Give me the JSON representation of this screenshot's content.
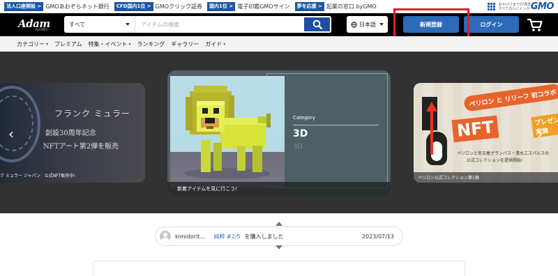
{
  "gmo_bar": {
    "items": [
      {
        "badge": "法人口座開設 >",
        "label": "GMOあおぞらネット銀行"
      },
      {
        "badge": "CFD国内1位 >",
        "label": "GMOクリック証券"
      },
      {
        "badge": "国内1位 >",
        "label": "電子印鑑GMOサイン"
      },
      {
        "badge": "夢を応援 >",
        "label": "起業の窓口 byGMO"
      }
    ],
    "tagline_1": "おかげさまで27周年",
    "tagline_2": "すべての人にインターネット",
    "logo": "GMO"
  },
  "header": {
    "logo": "Adam",
    "logo_sub": "byGMO",
    "search": {
      "category": "すべて",
      "placeholder": "アイテムの検索"
    },
    "language": "日本語",
    "signup_label": "新規登録",
    "login_label": "ログイン"
  },
  "nav": {
    "items": [
      {
        "label": "カテゴリー",
        "dropdown": "▾"
      },
      {
        "label": "プレミアム",
        "dropdown": ""
      },
      {
        "label": "特集・イベント",
        "dropdown": "▾"
      },
      {
        "label": "ランキング",
        "dropdown": ""
      },
      {
        "label": "ギャラリー",
        "dropdown": ""
      },
      {
        "label": "ガイド",
        "dropdown": "▾"
      }
    ]
  },
  "hero": {
    "left": {
      "title": "フランク ミュラー",
      "line2": "創設30周年記念",
      "line3": "NFTアート第2弾を販売",
      "caption": "ク ミュラー ジャパン　公式NFT販売中!"
    },
    "center": {
      "category_label": "Category",
      "category_value": "3D",
      "category_ghost": "3D",
      "caption": "新着アイテムを見に行こう!"
    },
    "right": {
      "headline": "ペリロン と リリーフ 初コラボ",
      "nft": "NFT",
      "present": "プレゼント実施",
      "desc_1": "ペリロンと名古屋グランパス・清水エスパルスの",
      "desc_2": "公式コレクションを提供開始!",
      "caption": "ペリロン公式コレクション第1弾",
      "brand": "ペリロン"
    }
  },
  "ticker": {
    "user": "kimidorit…",
    "item": "純粋 #2/5",
    "action": "を購入しました",
    "date": "2023/07/13"
  },
  "colors": {
    "accent": "#2d6ab8",
    "highlight": "#e02020",
    "header_bg": "#000000"
  }
}
